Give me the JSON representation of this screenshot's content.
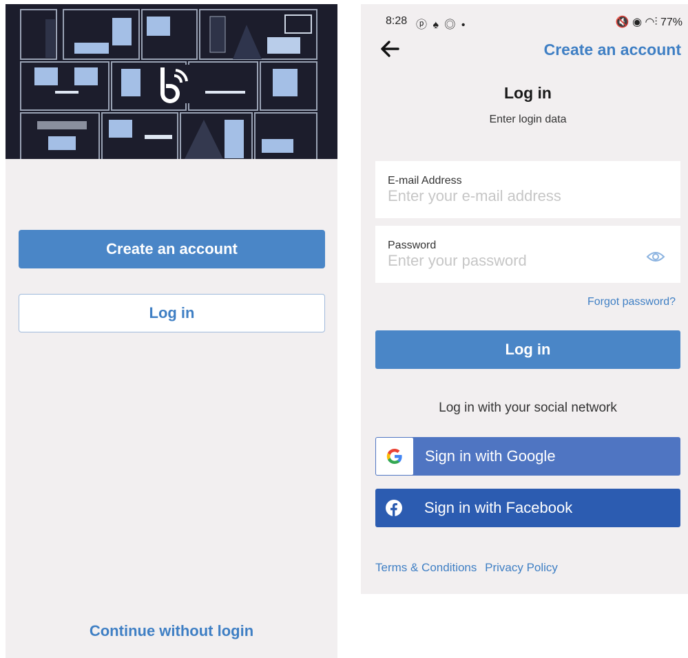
{
  "welcome_screen": {
    "create_account_label": "Create an account",
    "login_label": "Log in",
    "continue_label": "Continue without login"
  },
  "login_screen": {
    "status_bar": {
      "time": "8:28",
      "left_icons": "ⓟ ♠ ◎ •",
      "right_icons": "🔇 ◉ ◠⫶ 77%"
    },
    "create_account_link": "Create an account",
    "title": "Log in",
    "subtitle": "Enter login data",
    "email": {
      "label": "E-mail Address",
      "placeholder": "Enter your e-mail address",
      "value": ""
    },
    "password": {
      "label": "Password",
      "placeholder": "Enter your password",
      "value": ""
    },
    "forgot_label": "Forgot password?",
    "login_button_label": "Log in",
    "social_heading": "Log in with your social network",
    "google_label": "Sign in with Google",
    "facebook_label": "Sign in with Facebook",
    "terms_label": "Terms & Conditions",
    "privacy_label": "Privacy Policy"
  },
  "colors": {
    "accent": "#4a86c7",
    "link": "#3f7fc4",
    "google_button": "#4f75c2",
    "facebook_button": "#2c5cb1",
    "hero_background": "#1c1d2c"
  },
  "icons": [
    "app-logo-icon",
    "back-arrow-icon",
    "eye-icon",
    "google-logo-icon",
    "facebook-logo-icon"
  ]
}
